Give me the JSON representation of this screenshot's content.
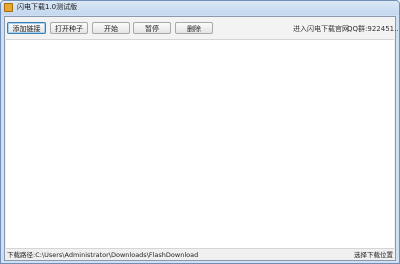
{
  "window": {
    "title": "闪电下载1.0测试版"
  },
  "toolbar": {
    "buttons": [
      {
        "label": "添加链接"
      },
      {
        "label": "打开种子"
      },
      {
        "label": "开始"
      },
      {
        "label": "暂停"
      },
      {
        "label": "删除"
      }
    ],
    "website_link": "进入闪电下载官网",
    "qq_group": "QQ群:922451..."
  },
  "statusbar": {
    "download_path": "下载路径:C:\\Users\\Administrator\\Downloads\\FlashDownload",
    "choose_location": "选择下载位置"
  }
}
